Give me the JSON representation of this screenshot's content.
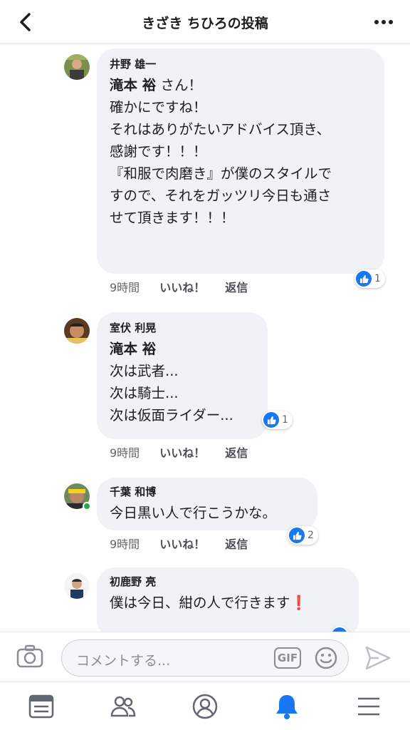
{
  "header": {
    "title": "きざき ちひろの投稿",
    "back_icon": "chevron-left-icon",
    "more_icon": "more-dots-icon"
  },
  "comments": [
    {
      "author": "井野 雄一",
      "mention": "滝本 裕",
      "mention_suffix": " さん！",
      "lines": [
        "",
        "確かにですね！",
        "それはありがたいアドバイス頂き、",
        "感謝です！！！",
        "",
        "『和服で肉磨き』が僕のスタイルで",
        "すので、それをガッツリ今日も通さ",
        "せて頂きます！！！"
      ],
      "time": "9時間",
      "like_label": "いいね！",
      "reply_label": "返信",
      "reaction_count": "1"
    },
    {
      "author": "室伏 利晃",
      "mention": "滝本 裕",
      "mention_suffix": "",
      "lines": [
        "次は武者...",
        "次は騎士...",
        "次は仮面ライダー..."
      ],
      "time": "9時間",
      "like_label": "いいね！",
      "reply_label": "返信",
      "reaction_count": "1"
    },
    {
      "author": "千葉 和博",
      "lines": [
        "今日黒い人で行こうかな。"
      ],
      "time": "9時間",
      "like_label": "いいね！",
      "reply_label": "返信",
      "reaction_count": "2",
      "online": true
    },
    {
      "author": "初鹿野 亮",
      "lines": [
        "僕は今日、紺の人で行きます"
      ],
      "emoji": "❗"
    }
  ],
  "composer": {
    "placeholder": "コメントする...",
    "gif_label": "GIF",
    "camera_icon": "camera-icon",
    "emoji_icon": "smiley-icon",
    "send_icon": "send-icon"
  },
  "bottom_nav": {
    "items": [
      "news-feed-icon",
      "friends-icon",
      "profile-icon",
      "notifications-bell-icon",
      "menu-icon"
    ],
    "active": "notifications-bell-icon"
  },
  "colors": {
    "accent": "#1877f2",
    "bubble": "#f0f2f5",
    "text": "#1c1e21",
    "muted": "#65676b"
  }
}
